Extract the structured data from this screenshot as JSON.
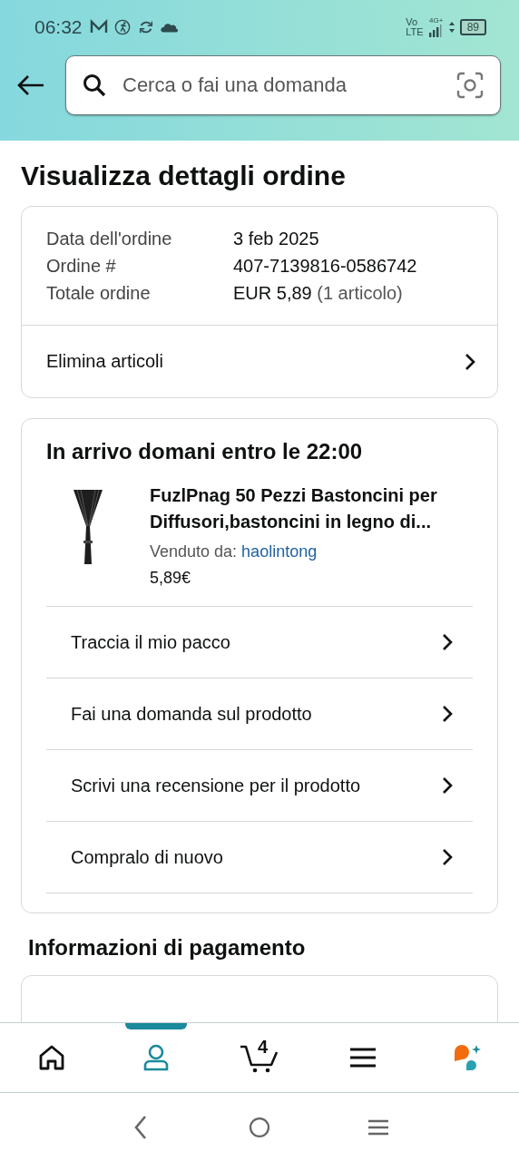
{
  "status_bar": {
    "time": "06:32",
    "network_top": "Vo",
    "network_bottom": "LTE",
    "signal_type": "4G+",
    "battery": "89"
  },
  "search": {
    "placeholder": "Cerca o fai una domanda"
  },
  "page_title": "Visualizza dettagli ordine",
  "order_summary": {
    "rows": [
      {
        "label": "Data dell'ordine",
        "value": "3 feb 2025",
        "note": ""
      },
      {
        "label": "Ordine #",
        "value": "407-7139816-0586742",
        "note": ""
      },
      {
        "label": "Totale ordine",
        "value": "EUR 5,89",
        "note": "(1 articolo)"
      }
    ],
    "action": "Elimina articoli"
  },
  "shipment": {
    "heading": "In arrivo domani entro le 22:00",
    "product": {
      "title": "FuzlPnag 50 Pezzi Bastoncini per Diffusori,bastoncini in legno di...",
      "seller_label": "Venduto da:",
      "seller": "haolintong",
      "price": "5,89€"
    },
    "actions": [
      "Traccia il mio pacco",
      "Fai una domanda sul prodotto",
      "Scrivi una recensione per il prodotto",
      "Compralo di nuovo"
    ]
  },
  "payment": {
    "heading": "Informazioni di pagamento"
  },
  "bottom_nav": [
    {
      "kind": "home",
      "selected": false
    },
    {
      "kind": "account",
      "selected": true
    },
    {
      "kind": "cart",
      "selected": false,
      "count": "4"
    },
    {
      "kind": "menu",
      "selected": false
    },
    {
      "kind": "assistant",
      "selected": false
    }
  ]
}
